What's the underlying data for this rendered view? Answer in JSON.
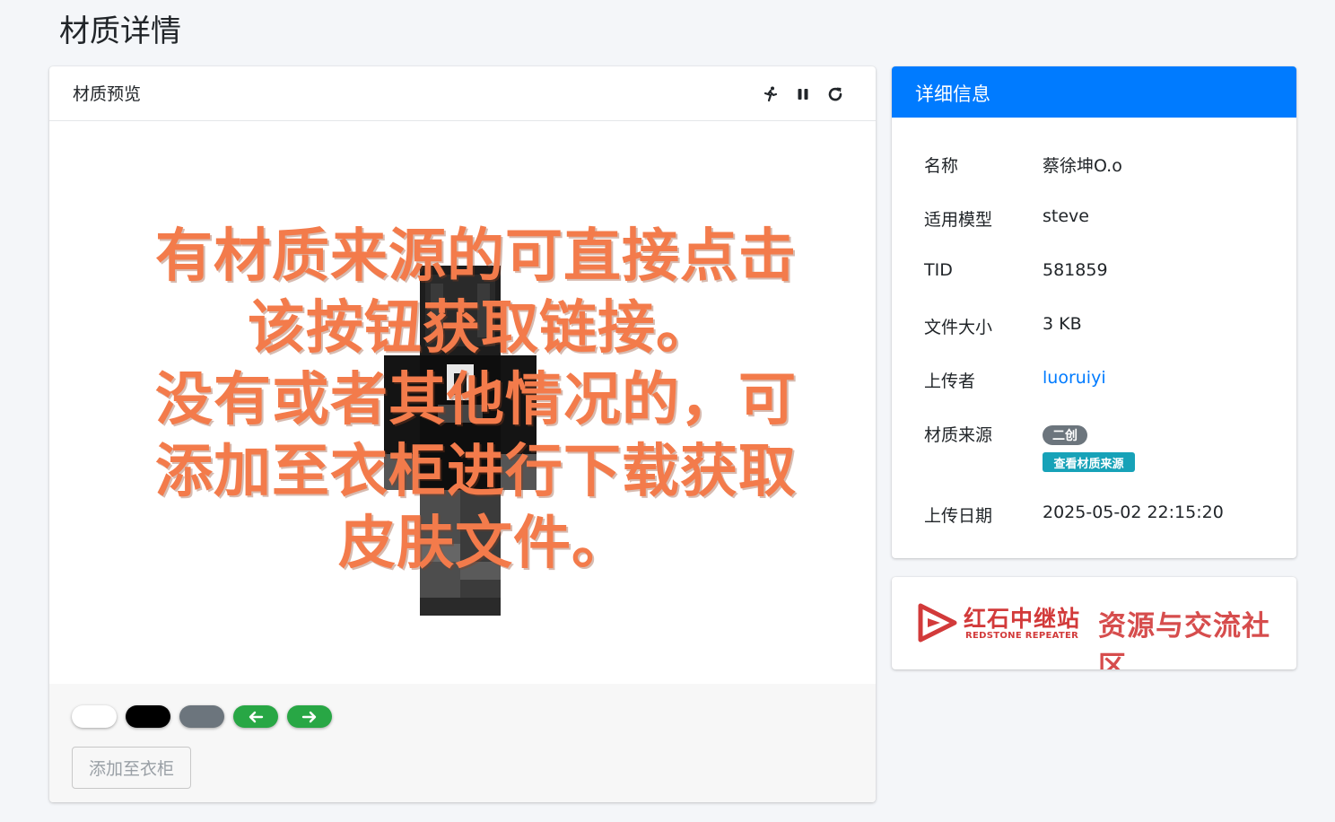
{
  "page": {
    "title": "材质详情"
  },
  "preview": {
    "title": "材质预览",
    "toolbar": {
      "run_icon": "running-icon",
      "pause_icon": "pause-icon",
      "reset_icon": "rotate-icon"
    },
    "overlay_lines": [
      "有材质来源的可直接点击",
      "该按钮获取链接。",
      "没有或者其他情况的，可",
      "添加至衣柜进行下载获取",
      "皮肤文件。"
    ],
    "overlay_color": "#f37b4b",
    "background_buttons": [
      "white",
      "black",
      "gray"
    ],
    "add_to_closet_label": "添加至衣柜"
  },
  "details": {
    "title": "详细信息",
    "rows": [
      {
        "label": "名称",
        "value": "蔡徐坤O.o"
      },
      {
        "label": "适用模型",
        "value": "steve"
      },
      {
        "label": "TID",
        "value": "581859"
      },
      {
        "label": "文件大小",
        "value": "3 KB"
      },
      {
        "label": "上传者",
        "value": "luoruiyi"
      },
      {
        "label": "材质来源",
        "badge": "二创",
        "link_badge": "查看材质来源"
      },
      {
        "label": "上传日期",
        "value": "2025-05-02 22:15:20"
      }
    ],
    "header_color": "#007bff"
  },
  "banner": {
    "brand": "红石中继站",
    "brand_en": "REDSTONE REPEATER",
    "slogan": "资源与交流社区",
    "color": "#d23a3a"
  }
}
